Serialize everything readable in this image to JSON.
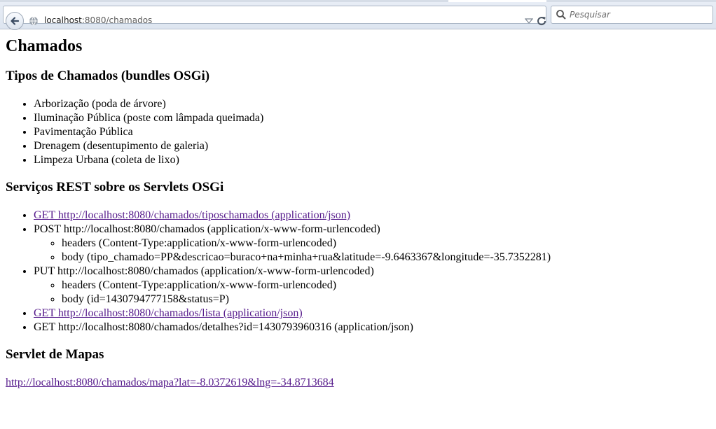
{
  "browser": {
    "url_host": "localhost",
    "url_path": ":8080/chamados",
    "search_placeholder": "Pesquisar"
  },
  "page": {
    "title": "Chamados",
    "section_types": {
      "heading": "Tipos de Chamados (bundles OSGi)",
      "items": [
        "Arborização (poda de árvore)",
        "Iluminação Pública (poste com lâmpada queimada)",
        "Pavimentação Pública",
        "Drenagem (desentupimento de galeria)",
        "Limpeza Urbana (coleta de lixo)"
      ]
    },
    "section_rest": {
      "heading": "Serviços REST sobre os Servlets OSGi",
      "get_tipos": "GET http://localhost:8080/chamados/tiposchamados (application/json)",
      "post": "POST http://localhost:8080/chamados (application/x-www-form-urlencoded)",
      "post_headers": "headers (Content-Type:application/x-www-form-urlencoded)",
      "post_body": "body (tipo_chamado=PP&descricao=buraco+na+minha+rua&latitude=-9.6463367&longitude=-35.7352281)",
      "put": "PUT http://localhost:8080/chamados (application/x-www-form-urlencoded)",
      "put_headers": "headers (Content-Type:application/x-www-form-urlencoded)",
      "put_body": "body (id=1430794777158&status=P)",
      "get_lista": "GET http://localhost:8080/chamados/lista (application/json)",
      "get_detalhes": "GET http://localhost:8080/chamados/detalhes?id=1430793960316 (application/json)"
    },
    "section_maps": {
      "heading": "Servlet de Mapas",
      "link": "http://localhost:8080/chamados/mapa?lat=-8.0372619&lng=-34.8713684"
    }
  }
}
